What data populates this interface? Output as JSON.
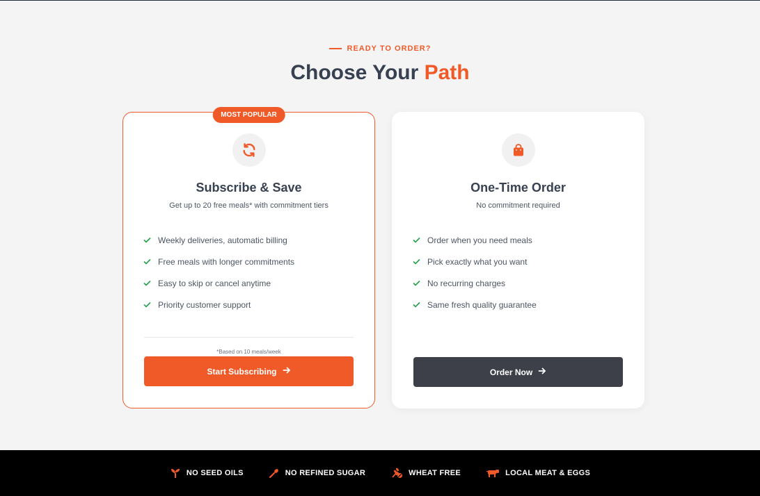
{
  "header": {
    "eyebrow": "READY TO ORDER?",
    "title_main": "Choose Your ",
    "title_accent": "Path"
  },
  "colors": {
    "accent": "#f05a28",
    "dark_button": "#3d4049",
    "check": "#22a04b"
  },
  "subscribe_card": {
    "badge": "MOST POPULAR",
    "icon": "refresh-icon",
    "title": "Subscribe & Save",
    "subtitle": "Get up to 20 free meals* with commitment tiers",
    "features": [
      "Weekly deliveries, automatic billing",
      "Free meals with longer commitments",
      "Easy to skip or cancel anytime",
      "Priority customer support"
    ],
    "footnote": "*Based on 10 meals/week",
    "button_label": "Start Subscribing"
  },
  "onetime_card": {
    "icon": "shopping-bag-icon",
    "title": "One-Time Order",
    "subtitle": "No commitment required",
    "features": [
      "Order when you need meals",
      "Pick exactly what you want",
      "No recurring charges",
      "Same fresh quality guarantee"
    ],
    "button_label": "Order Now"
  },
  "footer": {
    "items": [
      {
        "label": "NO SEED OILS",
        "icon": "sprout-icon"
      },
      {
        "label": "NO REFINED SUGAR",
        "icon": "candy-icon"
      },
      {
        "label": "WHEAT FREE",
        "icon": "wheat-off-icon"
      },
      {
        "label": "LOCAL MEAT & EGGS",
        "icon": "cow-icon"
      }
    ]
  }
}
